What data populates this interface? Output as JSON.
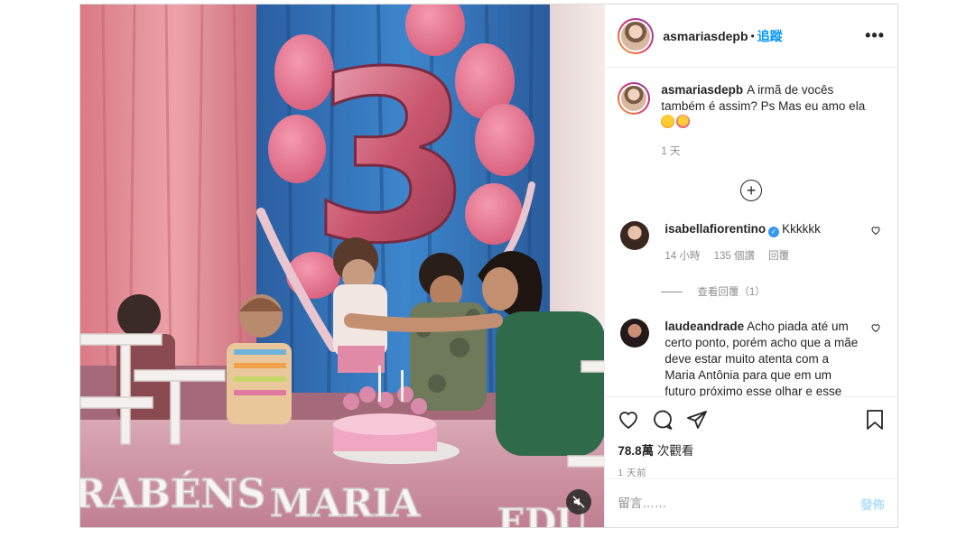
{
  "header": {
    "username": "asmariasdepb",
    "separator": "•",
    "follow_label": "追蹤",
    "more_label": "•••"
  },
  "caption": {
    "username": "asmariasdepb",
    "text": "A irmã de vocês também é assim? Ps Mas eu amo ela",
    "emojis": [
      "star-struck-emoji",
      "smiling-hearts-emoji"
    ],
    "time": "1 天"
  },
  "load_more": {
    "icon": "plus-circle-icon",
    "symbol": "+"
  },
  "comments": [
    {
      "username": "isabellafiorentino",
      "verified": true,
      "text": "Kkkkkk",
      "time": "14 小時",
      "likes": "135 個讚",
      "reply_label": "回覆",
      "view_replies": "查看回覆（1）"
    },
    {
      "username": "laudeandrade",
      "text": "Acho piada até um certo ponto, porém acho que a mãe deve estar muito atenta com a Maria Antônia para que em um futuro próximo esse olhar e esse"
    }
  ],
  "stats": {
    "views_count": "78.8萬",
    "views_label": "次觀看",
    "date": "1 天前"
  },
  "composer": {
    "placeholder": "留言……",
    "post_label": "發佈"
  },
  "media": {
    "overlay_text_left": "RABÉNS",
    "overlay_text_center": "MARIA",
    "overlay_text_right": "EDU",
    "balloon_number": "3",
    "accent_pink": "#c9566f",
    "backdrop_blue": "#2f6fb5"
  },
  "colors": {
    "link_blue": "#0095f6",
    "muted_gray": "#8e8e8e",
    "post_disabled": "#b2dffc"
  }
}
